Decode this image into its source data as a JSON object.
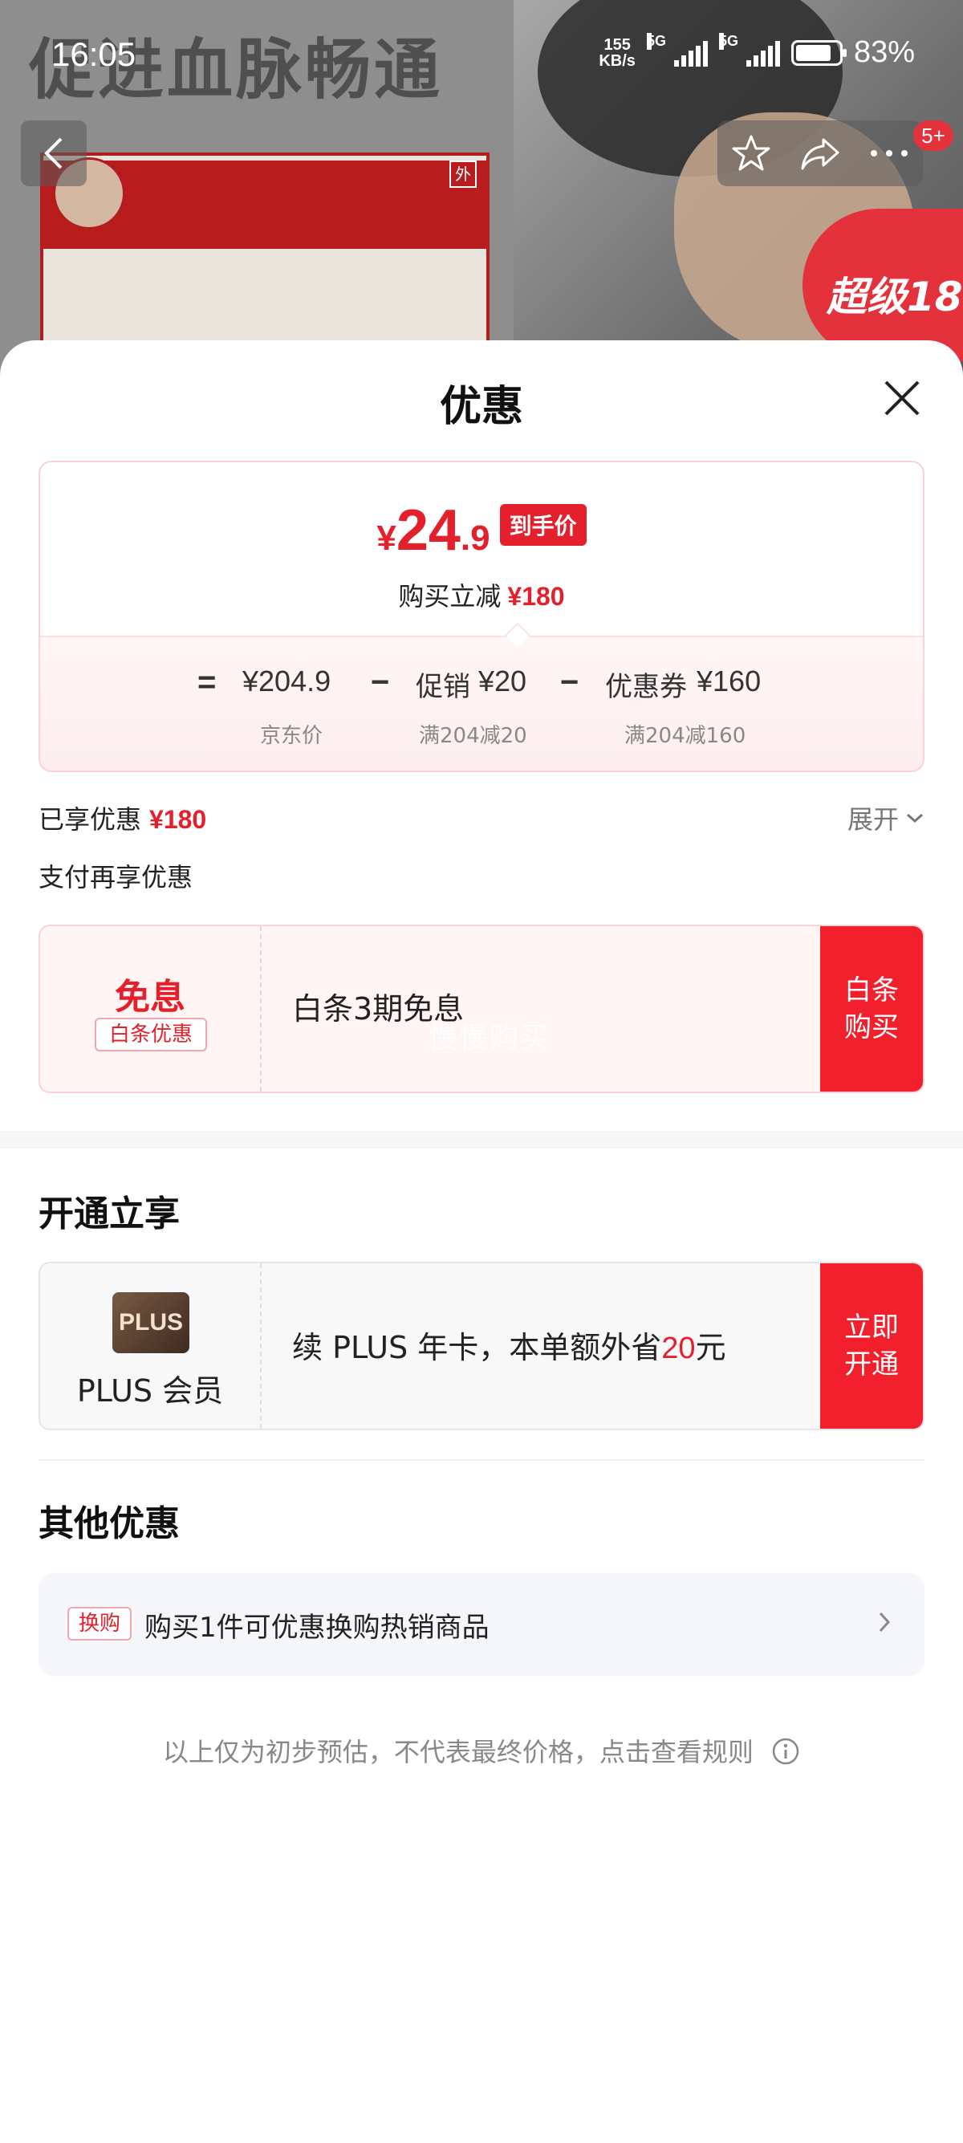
{
  "status_bar": {
    "time": "16:05",
    "net_speed_top": "155",
    "net_speed_bottom": "KB/s",
    "signal1_label": "5G",
    "signal2_label": "5G",
    "battery_pct": "83%"
  },
  "background": {
    "banner": "促进血脉畅通",
    "box_tag": "外",
    "super_badge": "超级18"
  },
  "nav": {
    "cart_badge": "5+"
  },
  "sheet": {
    "title": "优惠",
    "price": {
      "currency": "¥",
      "integer": "24",
      "decimal": ".9",
      "tag": "到手价",
      "direct_cut_label": "购买立减",
      "direct_cut_amount": "¥180"
    },
    "formula": {
      "eq": "=",
      "jd_price": "¥204.9",
      "minus1": "−",
      "promo_label": "促销",
      "promo_amount": "¥20",
      "minus2": "−",
      "coupon_label": "优惠券",
      "coupon_amount": "¥160",
      "jd_price_label": "京东价",
      "promo_rule": "满204减20",
      "coupon_rule": "满204减160"
    },
    "enjoyed_label": "已享优惠",
    "enjoyed_amount": "¥180",
    "expand_label": "展开",
    "pay_more_label": "支付再享优惠",
    "baitiao": {
      "title": "免息",
      "tag": "白条优惠",
      "desc": "白条3期免息",
      "watermark": "慢慢购买",
      "btn_line1": "白条",
      "btn_line2": "购买"
    },
    "open_section_title": "开通立享",
    "plus": {
      "logo": "PLUS",
      "name": "PLUS 会员",
      "desc_pre": "续 PLUS 年卡，本单额外省",
      "desc_amount": "20",
      "desc_post": "元",
      "btn_line1": "立即",
      "btn_line2": "开通"
    },
    "other_section_title": "其他优惠",
    "other": {
      "tag": "换购",
      "text": "购买1件可优惠换购热销商品"
    },
    "disclaimer": "以上仅为初步预估，不代表最终价格，点击查看规则"
  },
  "colors": {
    "accent": "#e4202c",
    "button_red": "#f2202d"
  }
}
